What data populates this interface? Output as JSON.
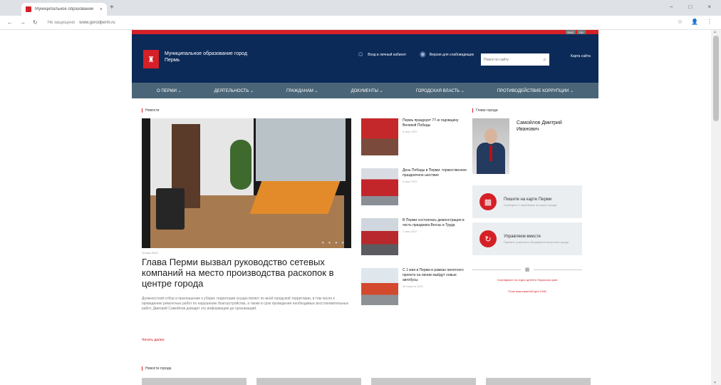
{
  "browser": {
    "tab_title": "Муниципальное образование",
    "tab_close": "×",
    "new_tab": "+",
    "window_controls": [
      "–",
      "□",
      "×"
    ],
    "url_security": "Не защищено",
    "url": "www.gorodperm.ru",
    "right_icons": [
      "☆",
      "👤",
      "⋮"
    ]
  },
  "site": {
    "colors": {
      "brand_red": "#d52027",
      "header_navy": "#0c2a58",
      "menu_slate": "#4a6577"
    },
    "lang_buttons": [
      "ENG",
      "RU"
    ],
    "name": "Муниципальное образование город Пермь",
    "login": "Вход в личный кабинет",
    "vision": "Версия для слабовидящих",
    "search_placeholder": "Поиск по сайту",
    "map": "Карта сайта",
    "menu": [
      "О ПЕРМИ ⌄",
      "ДЕЯТЕЛЬНОСТЬ ⌄",
      "ГРАЖДАНАМ ⌄",
      "ДОКУМЕНТЫ ⌄",
      "ГОРОДСКАЯ ВЛАСТЬ ⌄",
      "ПРОТИВОДЕЙСТВИЕ КОРРУПЦИИ ⌄"
    ]
  },
  "news": {
    "section_label": "Новости",
    "main": {
      "date": "19 мая 2022",
      "headline": "Глава Перми вызвал руководство сетевых компаний на место производства раскопок в центре города",
      "text": "Должностной отбор и приглашение к уборке территории осуществляет по всей городской территории, в том числе к проведению ремонтных работ по нарушению благоустройства, а также в срок проведения необходимых восстановительных работ. Дмитрий Самойлов доводит эту информацию до организаций.",
      "more": "Читать далее"
    },
    "side": [
      {
        "title": "Пермь празднует 77-ю годовщину Великой Победы",
        "date": "9 мая 2022"
      },
      {
        "title": "День Победы в Перми: торжественное праздничное шествие",
        "date": "9 мая 2022"
      },
      {
        "title": "В Перми состоялась демонстрация в честь праздника Весны и Труда",
        "date": "1 мая 2022"
      },
      {
        "title": "С 1 мая в Перми в рамках пилотного проекта на линию выйдут новые автобусы",
        "date": "30 апреля 2022"
      }
    ]
  },
  "mayor": {
    "section_label": "Глава города",
    "name": "Самойлов Дмитрий Иванович"
  },
  "cards": [
    {
      "icon": "map-icon",
      "glyph": "▦",
      "title": "Пишите на карте Перми",
      "text": "Сообщите о проблемах на карте города"
    },
    {
      "icon": "manage-icon",
      "glyph": "↻",
      "title": "Управляем вместе",
      "text": "Примите участие в обсуждении вопросов города"
    }
  ],
  "calendar_icon": "▦",
  "links": [
    "Сертификат на отдых детей в Пермском крае",
    "План мероприятий для СМИ"
  ],
  "city_news_label": "Новости города"
}
